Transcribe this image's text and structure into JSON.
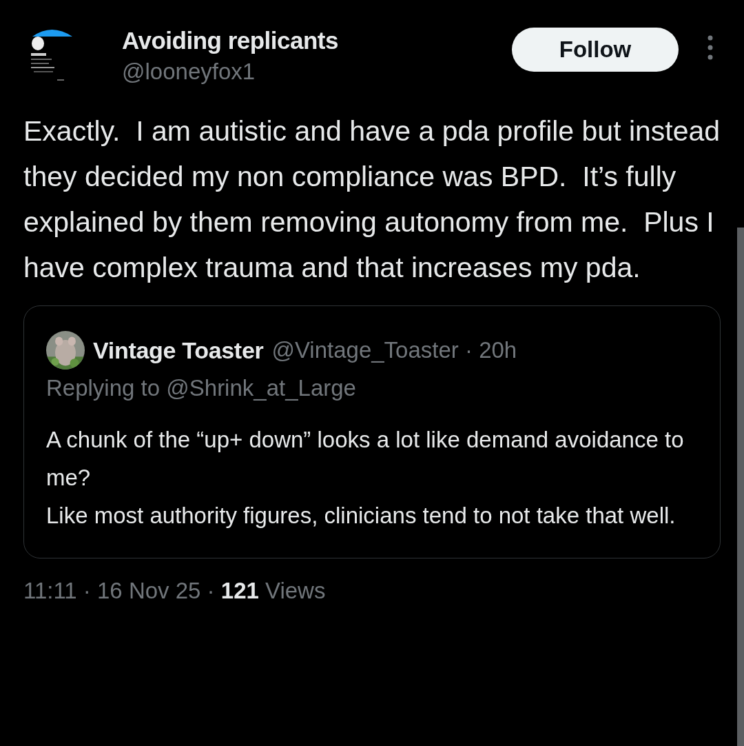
{
  "author": {
    "name": "Avoiding replicants",
    "handle": "@looneyfox1"
  },
  "follow_button": {
    "label": "Follow"
  },
  "text": "Exactly.  I am autistic and have a pda profile but instead they decided my non compliance was BPD.  It’s fully explained by them removing autonomy from me.  Plus I have complex trauma and that increases my pda.",
  "quoted": {
    "name": "Vintage Toaster",
    "handle_time": "@Vintage_Toaster · 20h",
    "replying_to": "Replying to @Shrink_at_Large",
    "text": "A chunk of the “up+ down” looks a lot like demand avoidance to me?\nLike most authority figures, clinicians tend to not take that well."
  },
  "meta": "11:11 · 16 Nov 25 · **121** Views"
}
